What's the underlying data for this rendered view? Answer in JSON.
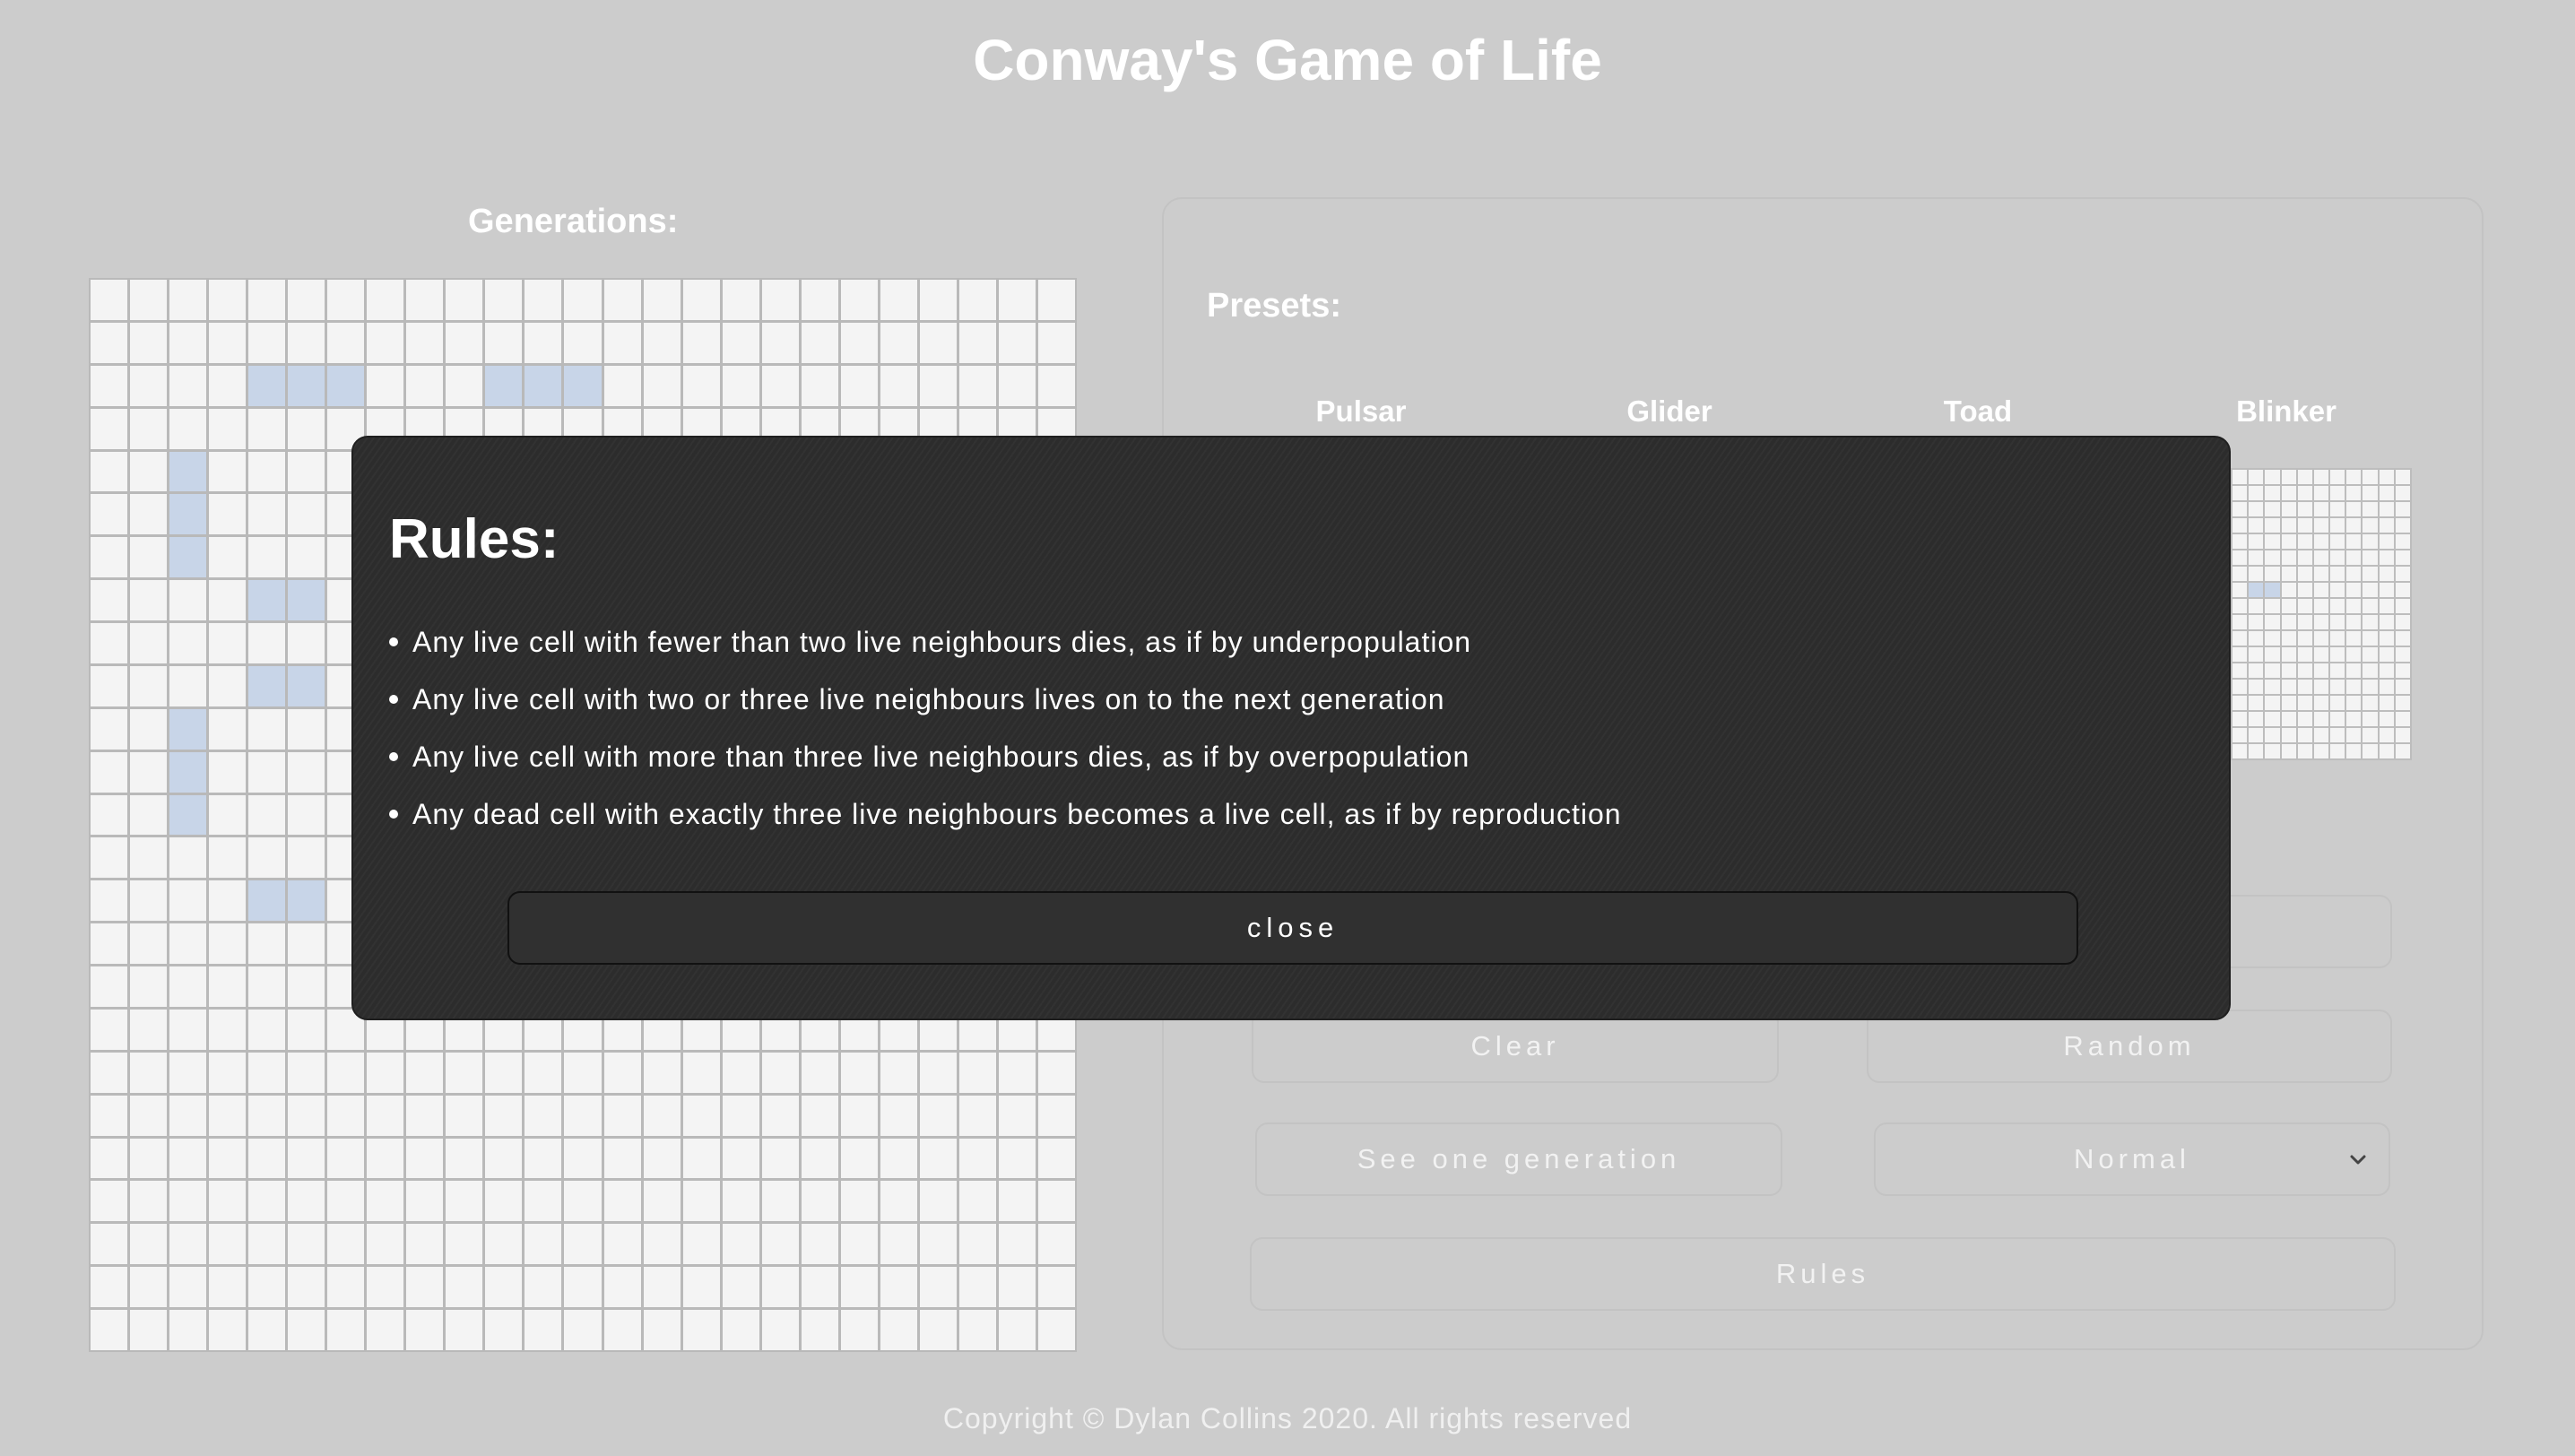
{
  "page": {
    "title": "Conway's Game of Life",
    "generations_label": "Generations:",
    "footer": "Copyright © Dylan Collins 2020. All rights reserved"
  },
  "board": {
    "alive_cells": [
      [
        2,
        4
      ],
      [
        2,
        5
      ],
      [
        2,
        6
      ],
      [
        2,
        10
      ],
      [
        2,
        11
      ],
      [
        2,
        12
      ],
      [
        4,
        2
      ],
      [
        5,
        2
      ],
      [
        6,
        2
      ],
      [
        7,
        4
      ],
      [
        7,
        5
      ],
      [
        9,
        4
      ],
      [
        9,
        5
      ],
      [
        10,
        2
      ],
      [
        11,
        2
      ],
      [
        12,
        2
      ],
      [
        14,
        4
      ],
      [
        14,
        5
      ]
    ]
  },
  "presets": {
    "label": "Presets:",
    "names": [
      "Pulsar",
      "Glider",
      "Toad",
      "Blinker"
    ],
    "blinker_alive_cells": [
      [
        7,
        1
      ],
      [
        7,
        2
      ]
    ]
  },
  "controls": {
    "clear": "Clear",
    "random": "Random",
    "step": "See one generation",
    "speed_selected": "Normal",
    "rules": "Rules"
  },
  "modal": {
    "title": "Rules:",
    "rules": [
      "Any live cell with fewer than two live neighbours dies, as if by underpopulation",
      "Any live cell with two or three live neighbours lives on to the next generation",
      "Any live cell with more than three live neighbours dies, as if by overpopulation",
      "Any dead cell with exactly three live neighbours becomes a live cell, as if by reproduction"
    ],
    "close": "close"
  },
  "colors": {
    "background": "#cccccc",
    "cell_dead": "#f4f4f4",
    "cell_alive": "#c8d5e8",
    "modal_bg": "#2d2d2d"
  }
}
